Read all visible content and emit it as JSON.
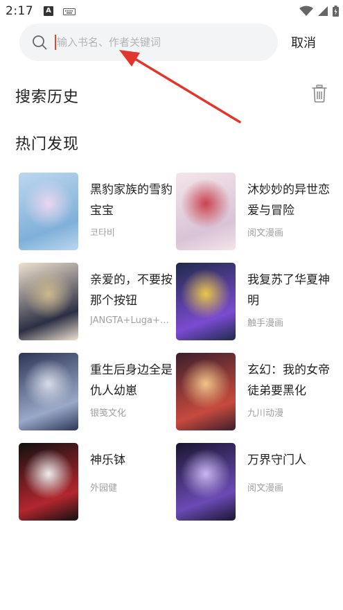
{
  "status_bar": {
    "time": "2:17",
    "a_badge": "A"
  },
  "search": {
    "placeholder": "输入书名、作者关键词",
    "value": "",
    "cancel_label": "取消"
  },
  "history": {
    "title": "搜索历史"
  },
  "hot": {
    "title": "热门发现",
    "books": [
      {
        "title": "黑豹家族的雪豹宝宝",
        "author": "코타비",
        "cover_colors": [
          "#bcd7ef",
          "#7fb0d8",
          "#e9d6f0"
        ]
      },
      {
        "title": "沐妙妙的异世恋爱与冒险",
        "author": "阅文漫画",
        "cover_colors": [
          "#f3e6ea",
          "#d9c3d6",
          "#c9434f"
        ]
      },
      {
        "title": "亲爱的，不要按那个按钮",
        "author": "JANGTA+Luga+…",
        "cover_colors": [
          "#efe3cf",
          "#2c2f45",
          "#cdb98e"
        ]
      },
      {
        "title": "我复苏了华夏神明",
        "author": "触手漫画",
        "cover_colors": [
          "#1f2a4a",
          "#7b4bd1",
          "#e9c84a"
        ]
      },
      {
        "title": "重生后身边全是仇人幼崽",
        "author": "银笺文化",
        "cover_colors": [
          "#2c3554",
          "#9aa9c8",
          "#d6dbe8"
        ]
      },
      {
        "title": "玄幻：我的女帝徒弟要黑化",
        "author": "九川动漫",
        "cover_colors": [
          "#3b1f2c",
          "#c74a3e",
          "#f1c48a"
        ]
      },
      {
        "title": "神乐钵",
        "author": "外园健",
        "cover_colors": [
          "#111111",
          "#b3262e",
          "#eeeeee"
        ]
      },
      {
        "title": "万界守门人",
        "author": "阅文漫画",
        "cover_colors": [
          "#1a1530",
          "#6a4bb5",
          "#c8b7f0"
        ]
      }
    ]
  },
  "colors": {
    "accent_arrow": "#e2352b",
    "cursor": "#e5452a",
    "search_bg": "#f3f4f6"
  }
}
